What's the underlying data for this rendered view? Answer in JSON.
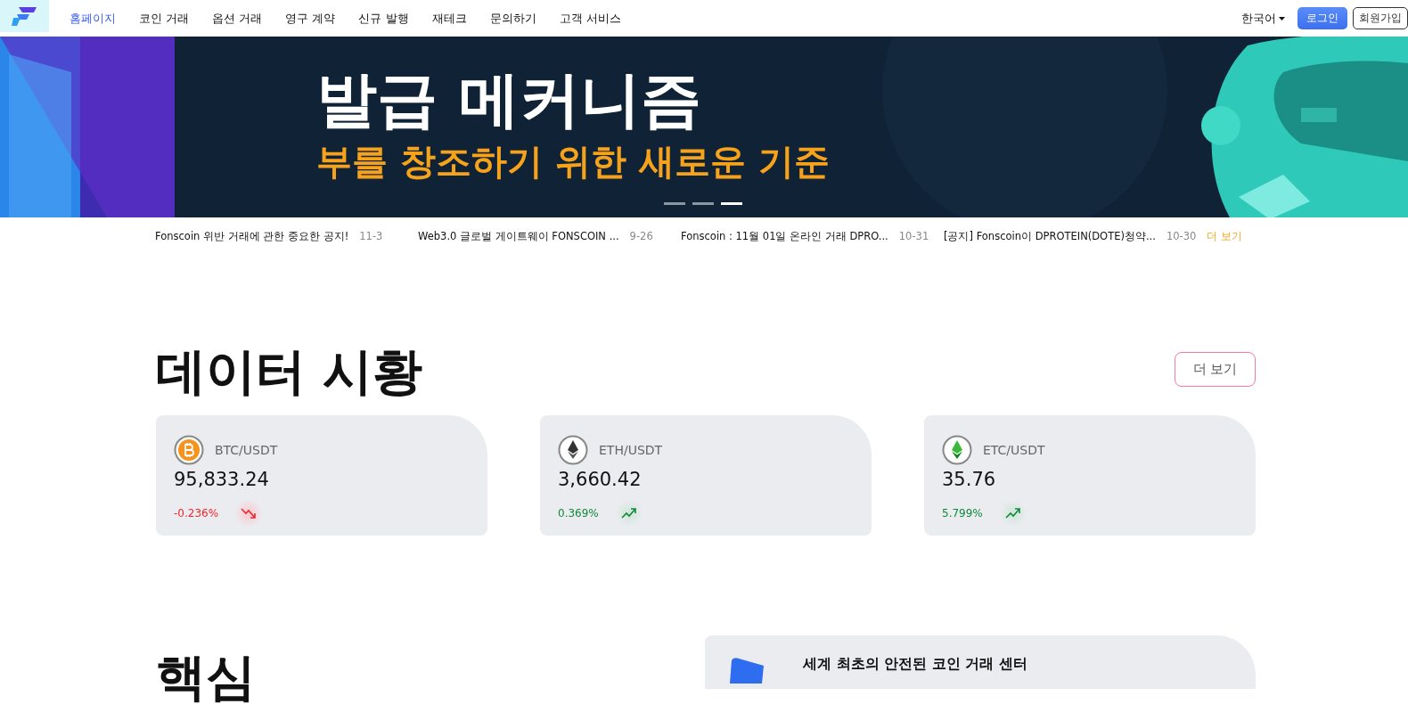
{
  "nav": {
    "items": [
      {
        "label": "홈페이지",
        "selected": true
      },
      {
        "label": "코인 거래",
        "selected": false
      },
      {
        "label": "옵션 거래",
        "selected": false
      },
      {
        "label": "영구 계약",
        "selected": false
      },
      {
        "label": "신규 발행",
        "selected": false
      },
      {
        "label": "재테크",
        "selected": false
      },
      {
        "label": "문의하기",
        "selected": false
      },
      {
        "label": "고객 서비스",
        "selected": false
      }
    ],
    "language": "한국어",
    "login": "로그인",
    "signup": "회원가입"
  },
  "banner": {
    "kind": "picture",
    "title": "발급 메커니즘",
    "subtitle": "부를 창조하기 위한 새로운 기준",
    "slides": [
      {
        "selected": false
      },
      {
        "selected": false
      },
      {
        "selected": true
      }
    ]
  },
  "notices": {
    "items": [
      {
        "title": "Fonscoin 위반 거래에 관한 중요한 공지!",
        "date": "11-3"
      },
      {
        "title": "Web3.0 글로벌 게이트웨이 FONSCOIN ...",
        "date": "9-26"
      },
      {
        "title": "Fonscoin : 11월 01일 온라인 거래 DPRO...",
        "date": "10-31"
      },
      {
        "title": "[공지] Fonscoin이 DPROTEIN(DOTE)청약...",
        "date": "10-30"
      }
    ],
    "more": "더 보기"
  },
  "market": {
    "title": "데이터 시황",
    "more": "더 보기",
    "cards": [
      {
        "kind": "btc",
        "pair": "BTC/USDT",
        "price": "95,833.24",
        "change": "-0.236%",
        "rising": false
      },
      {
        "kind": "eth",
        "pair": "ETH/USDT",
        "price": "3,660.42",
        "change": "0.369%",
        "rising": true
      },
      {
        "kind": "etc",
        "pair": "ETC/USDT",
        "price": "35.76",
        "change": "5.799%",
        "rising": true
      }
    ]
  },
  "core": {
    "title": "핵심",
    "feature": "세계 최초의 안전된 코인 거래 센터"
  }
}
